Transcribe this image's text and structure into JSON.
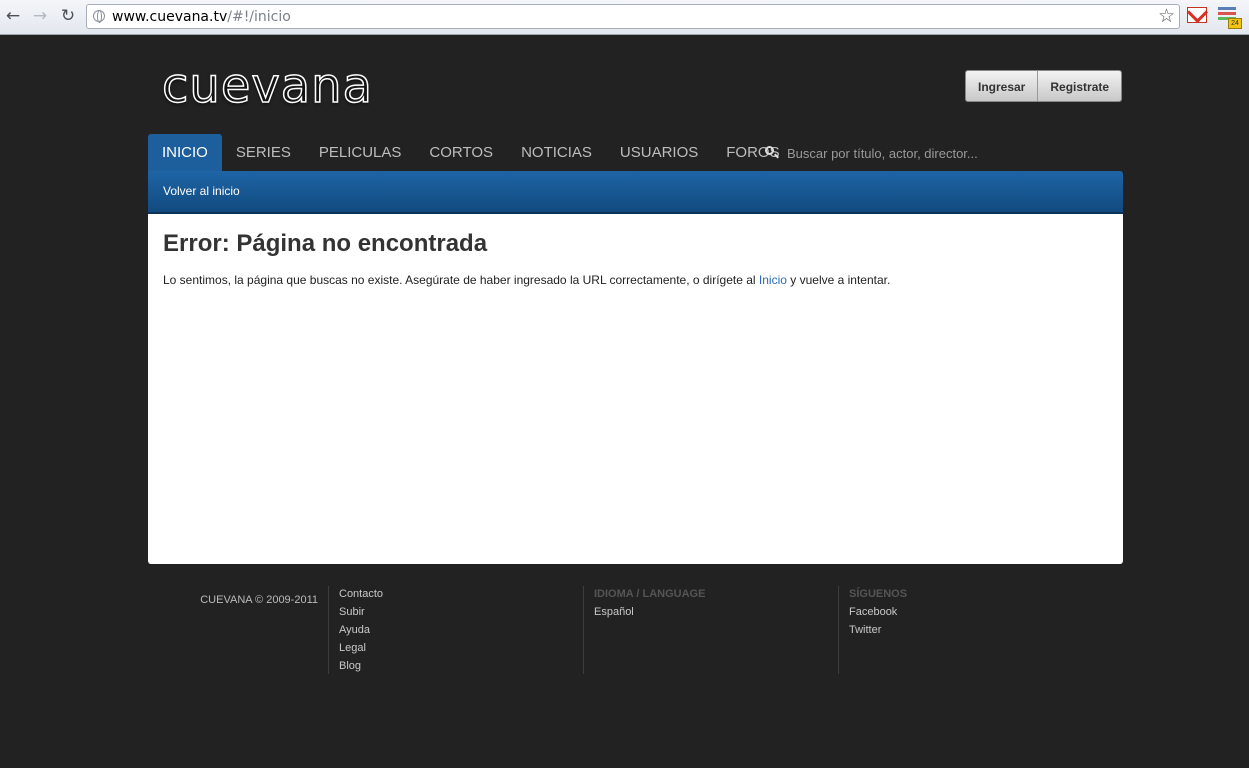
{
  "browser": {
    "url_host": "www.cuevana.tv",
    "url_path": "/#!/inicio",
    "back_glyph": "←",
    "forward_glyph": "→",
    "reload_glyph": "↻",
    "star_glyph": "☆",
    "ext_badge": "24"
  },
  "header": {
    "logo_text": "cuevana",
    "login_label": "Ingresar",
    "register_label": "Registrate"
  },
  "nav": {
    "items": [
      "INICIO",
      "SERIES",
      "PELICULAS",
      "CORTOS",
      "NOTICIAS",
      "USUARIOS",
      "FOROS"
    ],
    "active_index": 0,
    "search_placeholder": "Buscar por título, actor, director..."
  },
  "subbar": {
    "back_link": "Volver al inicio"
  },
  "content": {
    "title": "Error: Página no encontrada",
    "message_before": "Lo sentimos, la página que buscas no existe. Asegúrate de haber ingresado la URL correctamente, o dirígete al ",
    "message_link": "Inicio",
    "message_after": " y vuelve a intentar."
  },
  "footer": {
    "copyright": "CUEVANA © 2009-2011",
    "links": [
      "Contacto",
      "Subir",
      "Ayuda",
      "Legal",
      "Blog"
    ],
    "language_heading": "IDIOMA / LANGUAGE",
    "language": "Español",
    "social_heading": "SÍGUENOS",
    "social": [
      "Facebook",
      "Twitter"
    ]
  },
  "colors": {
    "page_bg": "#222222",
    "nav_active": "#1c5f9c",
    "subbar_top": "#1e65a6",
    "subbar_bottom": "#124a7f",
    "link": "#2a6cb5",
    "gmail_red": "#d93025"
  }
}
